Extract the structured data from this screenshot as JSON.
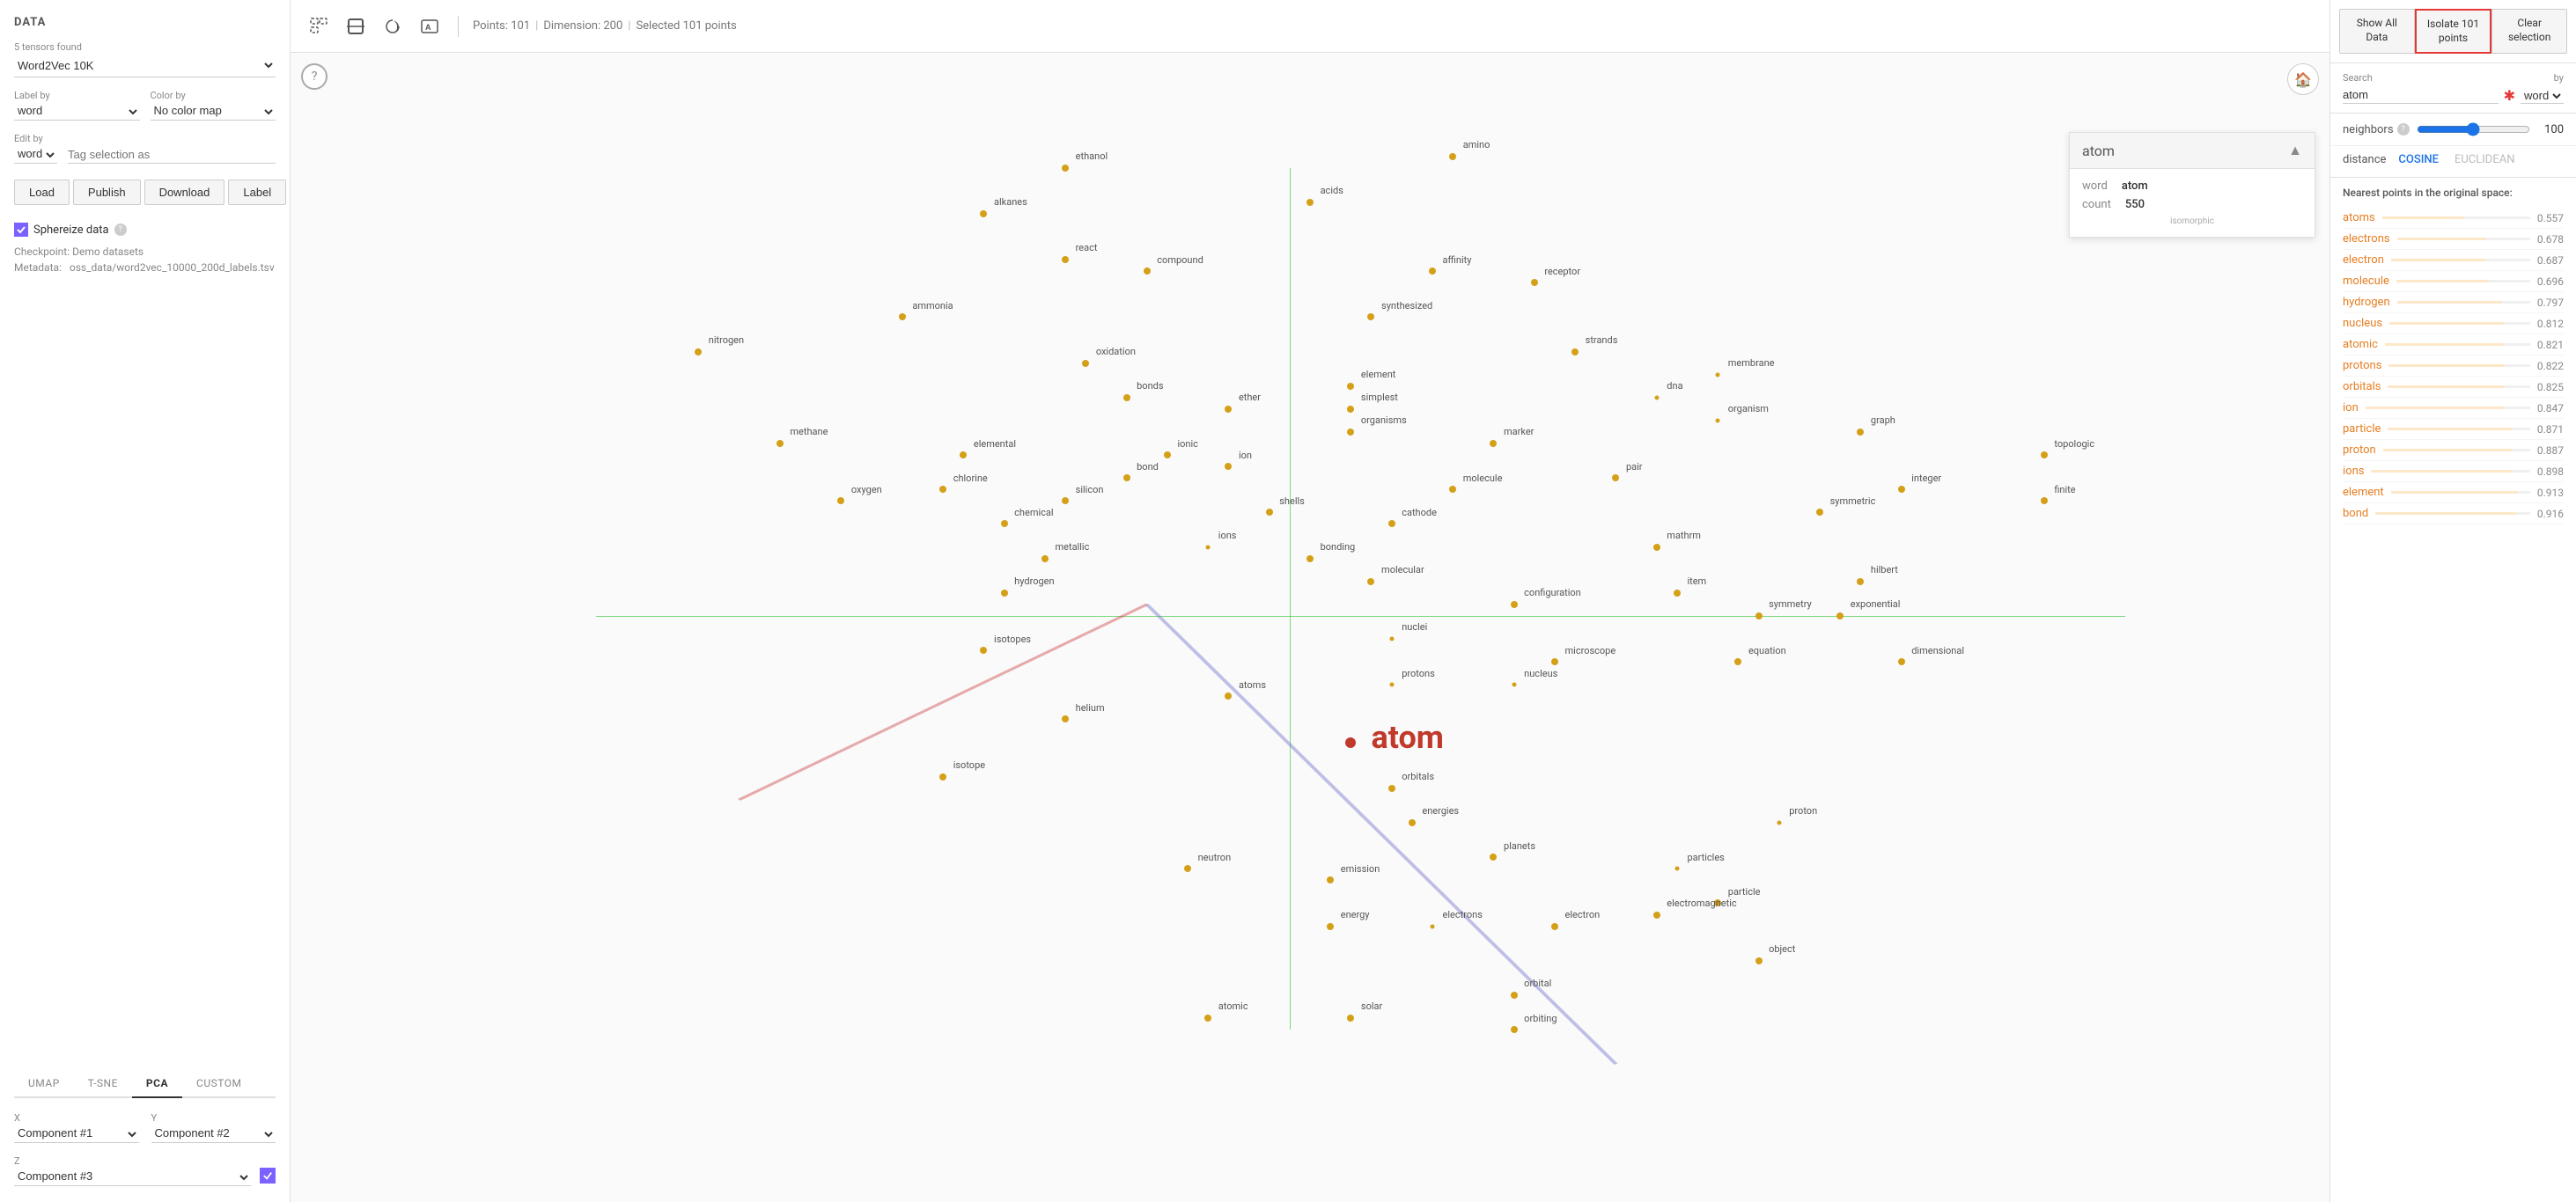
{
  "leftPanel": {
    "title": "DATA",
    "tensors": "5 tensors found",
    "selectedDataset": "Word2Vec 10K",
    "labelBy": "word",
    "colorBy": "No color map",
    "editBy": "word",
    "tagPlaceholder": "Tag selection as",
    "buttons": {
      "load": "Load",
      "publish": "Publish",
      "download": "Download",
      "label": "Label"
    },
    "sphereize": "Sphereize data",
    "checkpoint": "Demo datasets",
    "metadataPath": "oss_data/word2vec_10000_200d_labels.tsv",
    "projTabs": [
      "UMAP",
      "T-SNE",
      "PCA",
      "CUSTOM"
    ],
    "activeTab": "PCA",
    "xAxis": "Component #1",
    "yAxis": "Component #2",
    "zAxis": "Component #3"
  },
  "toolbar": {
    "points": "Points: 101",
    "dimension": "Dimension: 200",
    "selected": "Selected 101 points"
  },
  "scatter": {
    "words": [
      {
        "text": "ethanol",
        "x": 38,
        "y": 10,
        "size": "normal"
      },
      {
        "text": "amino",
        "x": 57,
        "y": 9,
        "size": "normal"
      },
      {
        "text": "acids",
        "x": 50,
        "y": 13,
        "size": "normal"
      },
      {
        "text": "alkanes",
        "x": 34,
        "y": 14,
        "size": "normal"
      },
      {
        "text": "react",
        "x": 38,
        "y": 18,
        "size": "normal"
      },
      {
        "text": "compound",
        "x": 42,
        "y": 19,
        "size": "normal"
      },
      {
        "text": "affinity",
        "x": 56,
        "y": 19,
        "size": "normal"
      },
      {
        "text": "receptor",
        "x": 61,
        "y": 20,
        "size": "normal"
      },
      {
        "text": "ammonia",
        "x": 30,
        "y": 23,
        "size": "normal"
      },
      {
        "text": "synthesized",
        "x": 53,
        "y": 23,
        "size": "normal"
      },
      {
        "text": "strands",
        "x": 63,
        "y": 26,
        "size": "normal"
      },
      {
        "text": "membrane",
        "x": 70,
        "y": 28,
        "size": "small"
      },
      {
        "text": "nitrogen",
        "x": 20,
        "y": 26,
        "size": "normal"
      },
      {
        "text": "oxidation",
        "x": 39,
        "y": 27,
        "size": "normal"
      },
      {
        "text": "element",
        "x": 52,
        "y": 29,
        "size": "normal"
      },
      {
        "text": "bonds",
        "x": 41,
        "y": 30,
        "size": "normal"
      },
      {
        "text": "ether",
        "x": 46,
        "y": 31,
        "size": "normal"
      },
      {
        "text": "simplest",
        "x": 52,
        "y": 31,
        "size": "normal"
      },
      {
        "text": "dna",
        "x": 67,
        "y": 30,
        "size": "small"
      },
      {
        "text": "organism",
        "x": 70,
        "y": 32,
        "size": "small"
      },
      {
        "text": "organisms",
        "x": 52,
        "y": 33,
        "size": "normal"
      },
      {
        "text": "marker",
        "x": 59,
        "y": 34,
        "size": "normal"
      },
      {
        "text": "methane",
        "x": 24,
        "y": 34,
        "size": "normal"
      },
      {
        "text": "elemental",
        "x": 33,
        "y": 35,
        "size": "normal"
      },
      {
        "text": "ionic",
        "x": 43,
        "y": 35,
        "size": "normal"
      },
      {
        "text": "ion",
        "x": 46,
        "y": 36,
        "size": "normal"
      },
      {
        "text": "graph",
        "x": 77,
        "y": 33,
        "size": "normal"
      },
      {
        "text": "pair",
        "x": 65,
        "y": 37,
        "size": "normal"
      },
      {
        "text": "bond",
        "x": 41,
        "y": 37,
        "size": "normal"
      },
      {
        "text": "chlorine",
        "x": 32,
        "y": 38,
        "size": "normal"
      },
      {
        "text": "molecule",
        "x": 57,
        "y": 38,
        "size": "normal"
      },
      {
        "text": "silicon",
        "x": 38,
        "y": 39,
        "size": "normal"
      },
      {
        "text": "integer",
        "x": 79,
        "y": 38,
        "size": "normal"
      },
      {
        "text": "symmetric",
        "x": 75,
        "y": 40,
        "size": "normal"
      },
      {
        "text": "chemical",
        "x": 35,
        "y": 41,
        "size": "normal"
      },
      {
        "text": "oxygen",
        "x": 27,
        "y": 39,
        "size": "normal"
      },
      {
        "text": "shells",
        "x": 48,
        "y": 40,
        "size": "normal"
      },
      {
        "text": "cathode",
        "x": 54,
        "y": 41,
        "size": "normal"
      },
      {
        "text": "mathrm",
        "x": 67,
        "y": 43,
        "size": "normal"
      },
      {
        "text": "item",
        "x": 68,
        "y": 47,
        "size": "normal"
      },
      {
        "text": "hilbert",
        "x": 77,
        "y": 46,
        "size": "normal"
      },
      {
        "text": "ions",
        "x": 45,
        "y": 43,
        "size": "small"
      },
      {
        "text": "bonding",
        "x": 50,
        "y": 44,
        "size": "normal"
      },
      {
        "text": "molecular",
        "x": 53,
        "y": 46,
        "size": "normal"
      },
      {
        "text": "metallic",
        "x": 37,
        "y": 44,
        "size": "normal"
      },
      {
        "text": "symmetry",
        "x": 72,
        "y": 49,
        "size": "normal"
      },
      {
        "text": "exponential",
        "x": 76,
        "y": 49,
        "size": "normal"
      },
      {
        "text": "configuration",
        "x": 60,
        "y": 48,
        "size": "normal"
      },
      {
        "text": "hydrogen",
        "x": 35,
        "y": 47,
        "size": "normal"
      },
      {
        "text": "dimensional",
        "x": 79,
        "y": 53,
        "size": "normal"
      },
      {
        "text": "nuclei",
        "x": 54,
        "y": 51,
        "size": "small"
      },
      {
        "text": "isotopes",
        "x": 34,
        "y": 52,
        "size": "normal"
      },
      {
        "text": "microscope",
        "x": 62,
        "y": 53,
        "size": "normal"
      },
      {
        "text": "equation",
        "x": 71,
        "y": 53,
        "size": "normal"
      },
      {
        "text": "nucleus",
        "x": 60,
        "y": 55,
        "size": "small"
      },
      {
        "text": "protons",
        "x": 54,
        "y": 55,
        "size": "small"
      },
      {
        "text": "atoms",
        "x": 46,
        "y": 56,
        "size": "normal"
      },
      {
        "text": "helium",
        "x": 38,
        "y": 58,
        "size": "normal"
      },
      {
        "text": "atom",
        "x": 52,
        "y": 60,
        "size": "large",
        "isSelected": true
      },
      {
        "text": "isotope",
        "x": 32,
        "y": 63,
        "size": "normal"
      },
      {
        "text": "orbitals",
        "x": 54,
        "y": 64,
        "size": "normal"
      },
      {
        "text": "energies",
        "x": 55,
        "y": 67,
        "size": "normal"
      },
      {
        "text": "neutron",
        "x": 44,
        "y": 71,
        "size": "normal"
      },
      {
        "text": "emission",
        "x": 51,
        "y": 72,
        "size": "normal"
      },
      {
        "text": "planets",
        "x": 59,
        "y": 70,
        "size": "normal"
      },
      {
        "text": "particles",
        "x": 68,
        "y": 71,
        "size": "small"
      },
      {
        "text": "energy",
        "x": 51,
        "y": 76,
        "size": "normal"
      },
      {
        "text": "electrons",
        "x": 56,
        "y": 76,
        "size": "small"
      },
      {
        "text": "electron",
        "x": 62,
        "y": 76,
        "size": "normal"
      },
      {
        "text": "particle",
        "x": 70,
        "y": 74,
        "size": "normal"
      },
      {
        "text": "electromagnetic",
        "x": 67,
        "y": 75,
        "size": "normal"
      },
      {
        "text": "object",
        "x": 72,
        "y": 79,
        "size": "normal"
      },
      {
        "text": "orbital",
        "x": 60,
        "y": 82,
        "size": "normal"
      },
      {
        "text": "atomic",
        "x": 45,
        "y": 84,
        "size": "normal"
      },
      {
        "text": "solar",
        "x": 52,
        "y": 84,
        "size": "normal"
      },
      {
        "text": "orbiting",
        "x": 60,
        "y": 85,
        "size": "normal"
      },
      {
        "text": "topologic",
        "x": 86,
        "y": 35,
        "size": "normal"
      },
      {
        "text": "finite",
        "x": 86,
        "y": 39,
        "size": "normal"
      },
      {
        "text": "proton",
        "x": 73,
        "y": 67,
        "size": "small"
      }
    ]
  },
  "popup": {
    "title": "atom",
    "wordKey": "word",
    "wordVal": "atom",
    "countKey": "count",
    "countVal": "550",
    "subtitle": "isomorphic"
  },
  "rightPanel": {
    "buttons": {
      "showAll": "Show All\nData",
      "isolate": "Isolate 101\npoints",
      "clear": "Clear\nselection"
    },
    "searchLabel": "Search",
    "byLabel": "by",
    "searchValue": "atom",
    "searchBy": "word",
    "neighborsLabel": "neighbors",
    "neighborsValue": 100,
    "distanceLabel": "distance",
    "distanceCosine": "COSINE",
    "distanceEuclidean": "EUCLIDEAN",
    "activeDist": "COSINE",
    "nearestTitle": "Nearest points in the original space:",
    "nearestPoints": [
      {
        "word": "atoms",
        "score": "0.557",
        "barWidth": 55
      },
      {
        "word": "electrons",
        "score": "0.678",
        "barWidth": 67
      },
      {
        "word": "electron",
        "score": "0.687",
        "barWidth": 68
      },
      {
        "word": "molecule",
        "score": "0.696",
        "barWidth": 69
      },
      {
        "word": "hydrogen",
        "score": "0.797",
        "barWidth": 79
      },
      {
        "word": "nucleus",
        "score": "0.812",
        "barWidth": 81
      },
      {
        "word": "atomic",
        "score": "0.821",
        "barWidth": 82
      },
      {
        "word": "protons",
        "score": "0.822",
        "barWidth": 82
      },
      {
        "word": "orbitals",
        "score": "0.825",
        "barWidth": 82
      },
      {
        "word": "ion",
        "score": "0.847",
        "barWidth": 84
      },
      {
        "word": "particle",
        "score": "0.871",
        "barWidth": 87
      },
      {
        "word": "proton",
        "score": "0.887",
        "barWidth": 88
      },
      {
        "word": "ions",
        "score": "0.898",
        "barWidth": 89
      },
      {
        "word": "element",
        "score": "0.913",
        "barWidth": 91
      },
      {
        "word": "bond",
        "score": "0.916",
        "barWidth": 91
      }
    ]
  }
}
